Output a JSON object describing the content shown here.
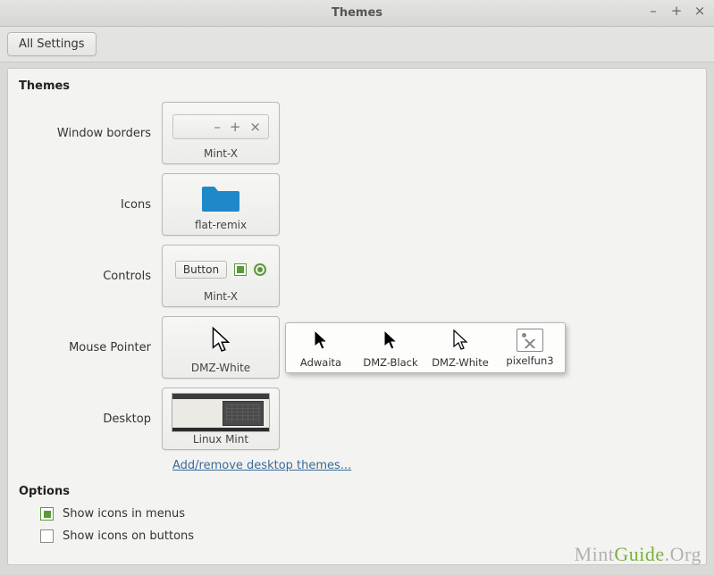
{
  "window": {
    "title": "Themes"
  },
  "toolbar": {
    "all_settings": "All Settings"
  },
  "sections": {
    "themes": "Themes",
    "options": "Options"
  },
  "rows": {
    "window_borders": {
      "label": "Window borders",
      "value": "Mint-X"
    },
    "icons": {
      "label": "Icons",
      "value": "flat-remix"
    },
    "controls": {
      "label": "Controls",
      "value": "Mint-X",
      "button_text": "Button"
    },
    "mouse_pointer": {
      "label": "Mouse Pointer",
      "value": "DMZ-White"
    },
    "desktop": {
      "label": "Desktop",
      "value": "Linux Mint"
    }
  },
  "pointer_options": [
    {
      "name": "Adwaita"
    },
    {
      "name": "DMZ-Black"
    },
    {
      "name": "DMZ-White"
    },
    {
      "name": "pixelfun3"
    }
  ],
  "link": {
    "add_remove": "Add/remove desktop themes..."
  },
  "options": {
    "menus": {
      "label": "Show icons in menus",
      "checked": true
    },
    "buttons": {
      "label": "Show icons on buttons",
      "checked": false
    }
  },
  "watermark": {
    "a": "Mint",
    "b": "Guide",
    "c": ".Org"
  }
}
